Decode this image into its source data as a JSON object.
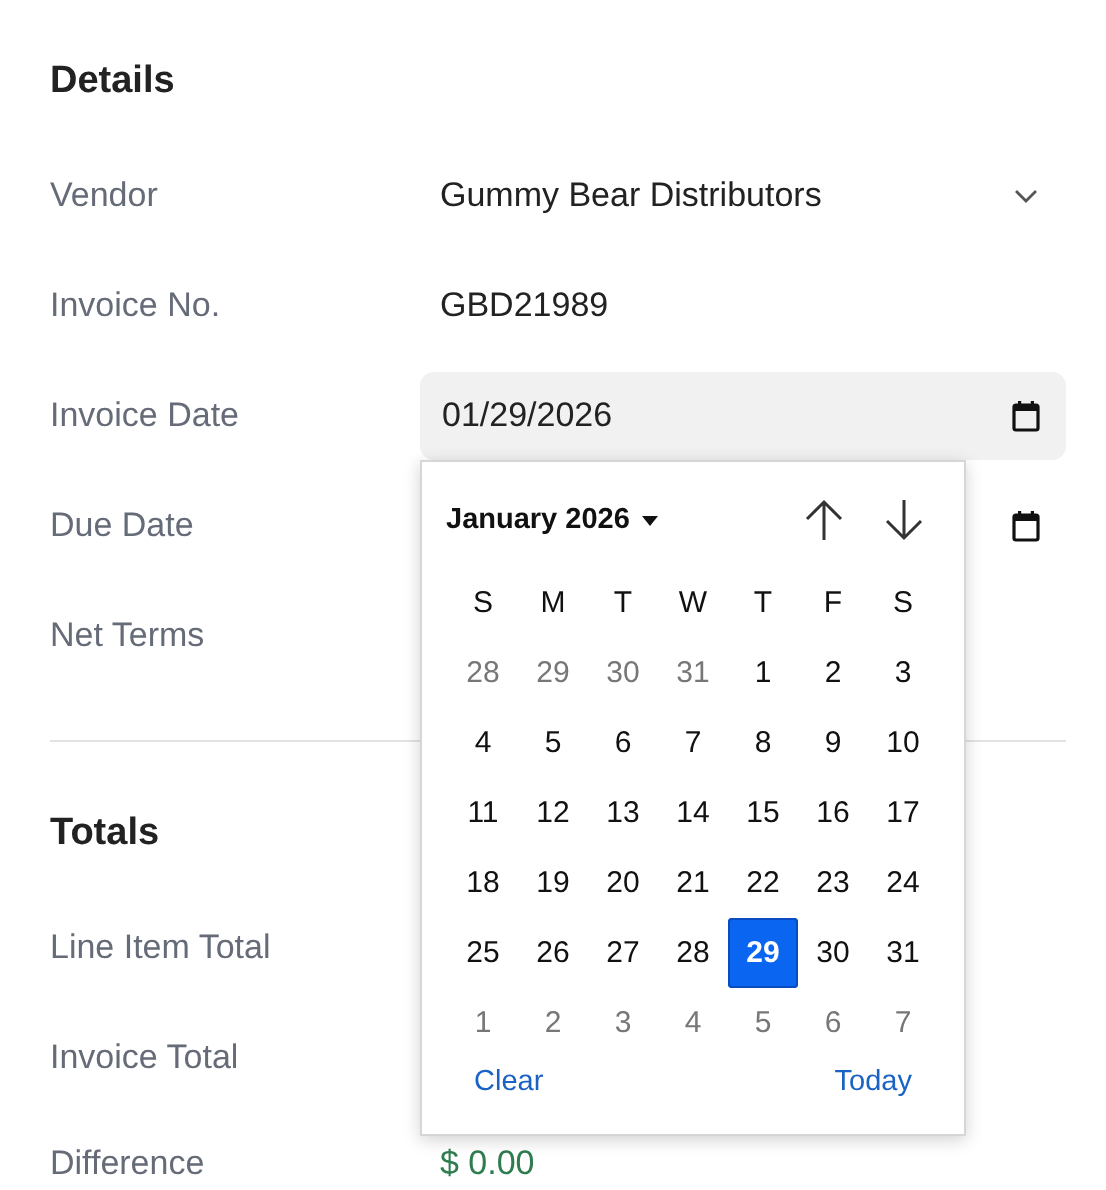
{
  "details": {
    "heading": "Details",
    "rows": [
      {
        "label": "Vendor",
        "kind": "select",
        "value": "Gummy Bear Distributors"
      },
      {
        "label": "Invoice No.",
        "kind": "text",
        "value": "GBD21989"
      },
      {
        "label": "Invoice Date",
        "kind": "date",
        "value": "01/29/2026",
        "open": true
      },
      {
        "label": "Due Date",
        "kind": "date",
        "value": "",
        "open": false
      },
      {
        "label": "Net Terms",
        "kind": "hidden"
      }
    ]
  },
  "totals": {
    "heading": "Totals",
    "rows": [
      {
        "label": "Line Item Total",
        "kind": "hidden"
      },
      {
        "label": "Invoice Total",
        "kind": "hidden"
      },
      {
        "label": "Difference",
        "kind": "amount",
        "value": "$ 0.00"
      }
    ]
  },
  "calendar": {
    "month": "January 2026",
    "weekdays": [
      "S",
      "M",
      "T",
      "W",
      "T",
      "F",
      "S"
    ],
    "weeks": [
      [
        {
          "day": "28",
          "outside": true,
          "selected": false
        },
        {
          "day": "29",
          "outside": true,
          "selected": false
        },
        {
          "day": "30",
          "outside": true,
          "selected": false
        },
        {
          "day": "31",
          "outside": true,
          "selected": false
        },
        {
          "day": "1",
          "outside": false,
          "selected": false
        },
        {
          "day": "2",
          "outside": false,
          "selected": false
        },
        {
          "day": "3",
          "outside": false,
          "selected": false
        }
      ],
      [
        {
          "day": "4",
          "outside": false,
          "selected": false
        },
        {
          "day": "5",
          "outside": false,
          "selected": false
        },
        {
          "day": "6",
          "outside": false,
          "selected": false
        },
        {
          "day": "7",
          "outside": false,
          "selected": false
        },
        {
          "day": "8",
          "outside": false,
          "selected": false
        },
        {
          "day": "9",
          "outside": false,
          "selected": false
        },
        {
          "day": "10",
          "outside": false,
          "selected": false
        }
      ],
      [
        {
          "day": "11",
          "outside": false,
          "selected": false
        },
        {
          "day": "12",
          "outside": false,
          "selected": false
        },
        {
          "day": "13",
          "outside": false,
          "selected": false
        },
        {
          "day": "14",
          "outside": false,
          "selected": false
        },
        {
          "day": "15",
          "outside": false,
          "selected": false
        },
        {
          "day": "16",
          "outside": false,
          "selected": false
        },
        {
          "day": "17",
          "outside": false,
          "selected": false
        }
      ],
      [
        {
          "day": "18",
          "outside": false,
          "selected": false
        },
        {
          "day": "19",
          "outside": false,
          "selected": false
        },
        {
          "day": "20",
          "outside": false,
          "selected": false
        },
        {
          "day": "21",
          "outside": false,
          "selected": false
        },
        {
          "day": "22",
          "outside": false,
          "selected": false
        },
        {
          "day": "23",
          "outside": false,
          "selected": false
        },
        {
          "day": "24",
          "outside": false,
          "selected": false
        }
      ],
      [
        {
          "day": "25",
          "outside": false,
          "selected": false
        },
        {
          "day": "26",
          "outside": false,
          "selected": false
        },
        {
          "day": "27",
          "outside": false,
          "selected": false
        },
        {
          "day": "28",
          "outside": false,
          "selected": false
        },
        {
          "day": "29",
          "outside": false,
          "selected": true
        },
        {
          "day": "30",
          "outside": false,
          "selected": false
        },
        {
          "day": "31",
          "outside": false,
          "selected": false
        }
      ],
      [
        {
          "day": "1",
          "outside": true,
          "selected": false
        },
        {
          "day": "2",
          "outside": true,
          "selected": false
        },
        {
          "day": "3",
          "outside": true,
          "selected": false
        },
        {
          "day": "4",
          "outside": true,
          "selected": false
        },
        {
          "day": "5",
          "outside": true,
          "selected": false
        },
        {
          "day": "6",
          "outside": true,
          "selected": false
        },
        {
          "day": "7",
          "outside": true,
          "selected": false
        }
      ]
    ],
    "clear": "Clear",
    "today": "Today"
  }
}
